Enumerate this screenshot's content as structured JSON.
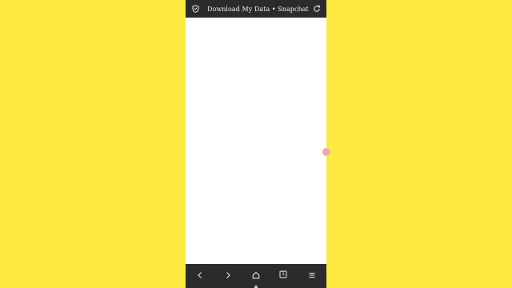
{
  "background_color": "#fde93f",
  "browser": {
    "page_title": "Download My Data • Snapchat",
    "icons": {
      "security": "shield-icon",
      "reload": "reload-icon"
    }
  },
  "navigation": {
    "items": [
      {
        "name": "back",
        "icon": "chevron-left-icon"
      },
      {
        "name": "forward",
        "icon": "chevron-right-icon"
      },
      {
        "name": "home",
        "icon": "home-icon"
      },
      {
        "name": "tabs",
        "icon": "tabs-icon",
        "count": "1"
      },
      {
        "name": "menu",
        "icon": "menu-icon"
      }
    ]
  }
}
